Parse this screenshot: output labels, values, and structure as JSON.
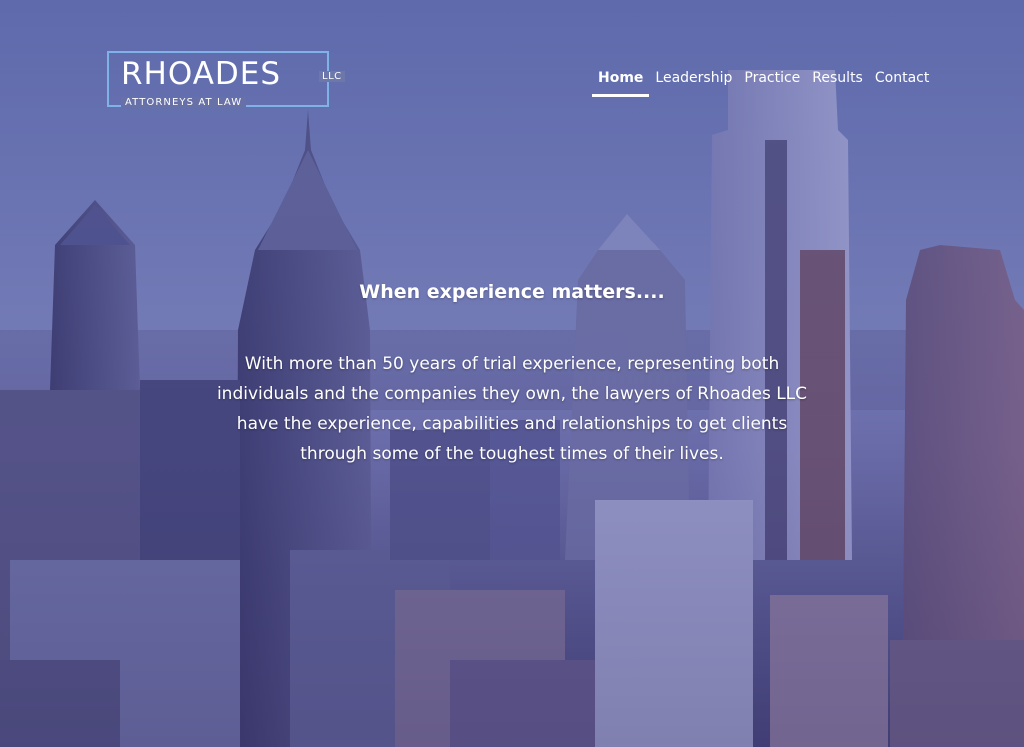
{
  "brand": {
    "name": "RHOADES",
    "suffix": "LLC",
    "tagline": "ATTORNEYS AT LAW"
  },
  "nav": {
    "items": [
      {
        "label": "Home",
        "active": true
      },
      {
        "label": "Leadership",
        "active": false
      },
      {
        "label": "Practice",
        "active": false
      },
      {
        "label": "Results",
        "active": false
      },
      {
        "label": "Contact",
        "active": false
      }
    ]
  },
  "hero": {
    "headline": "When experience matters....",
    "body": "With more than 50 years of trial experience, representing both individuals and the companies they own, the lawyers of Rhoades LLC have the experience, capabilities and relationships to get clients through some of the toughest times of their lives.",
    "background": "city-skyline-aerial-photo"
  },
  "colors": {
    "overlay": "#5a5f93",
    "logo_border": "#7fb2e6",
    "text": "#ffffff"
  }
}
